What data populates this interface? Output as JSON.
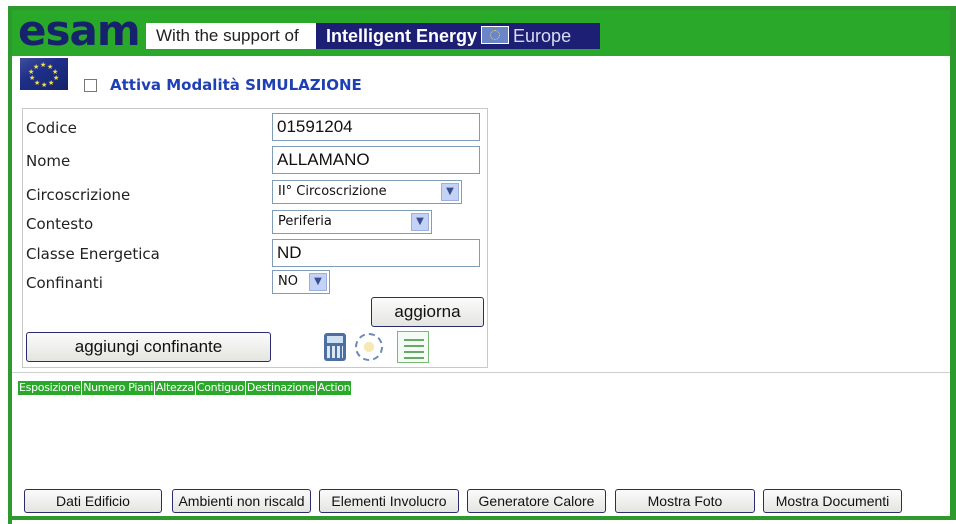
{
  "header": {
    "logo": "esam",
    "support_text": "With the support of",
    "program_name": "Intelligent Energy",
    "program_region": "Europe"
  },
  "simulation": {
    "checked": false,
    "label": "Attiva Modalità SIMULAZIONE"
  },
  "form": {
    "codice": {
      "label": "Codice",
      "value": "01591204"
    },
    "nome": {
      "label": "Nome",
      "value": "ALLAMANO"
    },
    "circoscrizione": {
      "label": "Circoscrizione",
      "value": "II° Circoscrizione"
    },
    "contesto": {
      "label": "Contesto",
      "value": "Periferia"
    },
    "classe_energetica": {
      "label": "Classe Energetica",
      "value": "ND"
    },
    "confinanti": {
      "label": "Confinanti",
      "value": "NO"
    },
    "update_button": "aggiorna",
    "add_neighbor_button": "aggiungi confinante"
  },
  "icons": [
    "calculator-icon",
    "globe-icon",
    "list-icon"
  ],
  "table": {
    "columns": [
      "Esposizione",
      "Numero Piani",
      "Altezza",
      "Contiguo",
      "Destinazione",
      "Action"
    ]
  },
  "bottom_buttons": [
    "Dati Edificio",
    "Ambienti non riscald",
    "Elementi Involucro",
    "Generatore Calore",
    "Mostra Foto",
    "Mostra Documenti"
  ],
  "colors": {
    "brand_green": "#2aa82a",
    "logo_navy": "#16226b",
    "program_navy": "#1c1f73",
    "simulation_blue": "#1f3fb5"
  }
}
